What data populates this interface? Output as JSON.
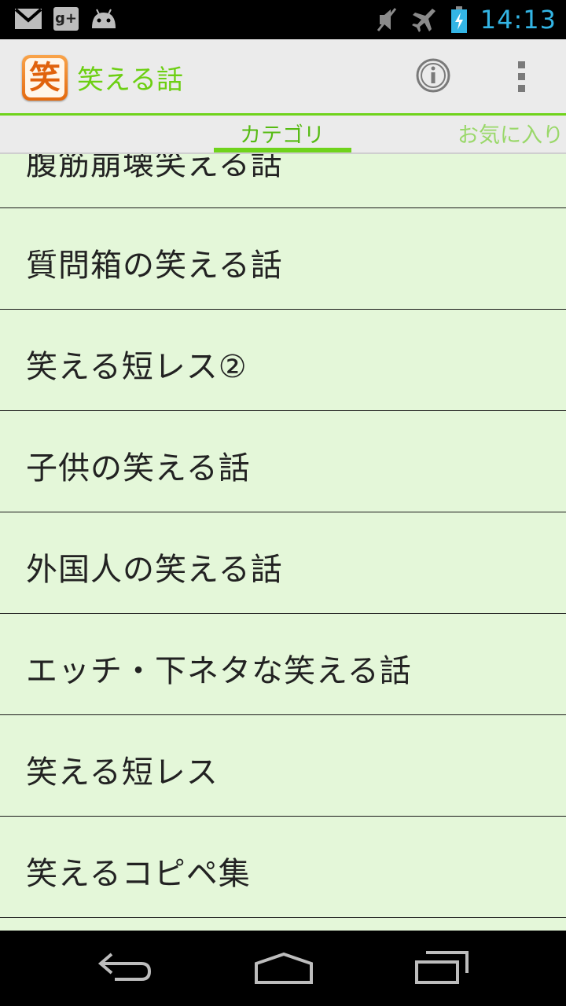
{
  "status_bar": {
    "time": "14:13",
    "icons": [
      "gmail-icon",
      "google-plus-icon",
      "android-icon",
      "mute-icon",
      "airplane-icon",
      "battery-charging-icon"
    ],
    "gplus_label": "g+"
  },
  "action_bar": {
    "app_icon_glyph": "笑",
    "title": "笑える話",
    "actions": [
      "info-icon",
      "overflow-menu-icon"
    ]
  },
  "tabs": {
    "items": [
      {
        "label": "カテゴリ",
        "selected": true
      },
      {
        "label": "お気に入り",
        "selected": false
      }
    ]
  },
  "list": {
    "items": [
      {
        "label": "腹筋崩壊笑える話"
      },
      {
        "label": "質問箱の笑える話"
      },
      {
        "label": "笑える短レス②"
      },
      {
        "label": "子供の笑える話"
      },
      {
        "label": "外国人の笑える話"
      },
      {
        "label": "エッチ・下ネタな笑える話"
      },
      {
        "label": "笑える短レス"
      },
      {
        "label": "笑えるコピペ集"
      }
    ]
  },
  "nav_bar": {
    "buttons": [
      "back-icon",
      "home-icon",
      "recent-apps-icon"
    ]
  },
  "colors": {
    "accent": "#6fd31b",
    "list_background": "#e4f7d9",
    "clock": "#33b5e5"
  }
}
